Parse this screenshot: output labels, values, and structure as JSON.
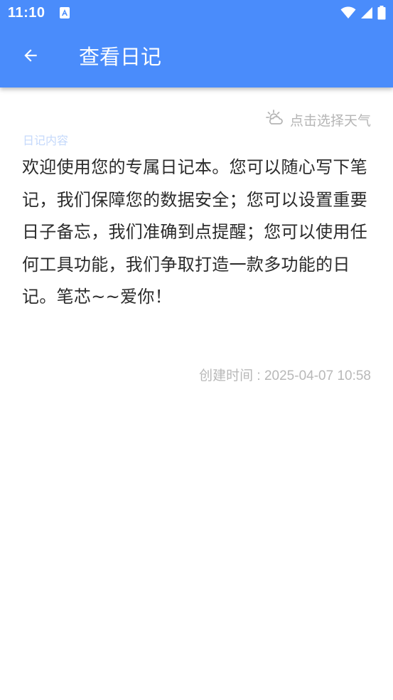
{
  "status_bar": {
    "time": "11:10",
    "notification_icon": "accessibility-notification-icon",
    "icons": [
      "wifi-icon",
      "signal-icon",
      "battery-icon"
    ]
  },
  "app_bar": {
    "back_icon": "arrow-left-icon",
    "title": "查看日记",
    "background_color": "#4a8cfb"
  },
  "weather": {
    "icon": "weather-sun-cloud-icon",
    "label": "点击选择天气"
  },
  "diary": {
    "content_label": "日记内容",
    "content": "欢迎使用您的专属日记本。您可以随心写下笔记，我们保障您的数据安全；您可以设置重要日子备忘，我们准确到点提醒；您可以使用任何工具功能，我们争取打造一款多功能的日记。笔芯~~爱你！",
    "created_time": "创建时间 : 2025-04-07 10:58"
  }
}
